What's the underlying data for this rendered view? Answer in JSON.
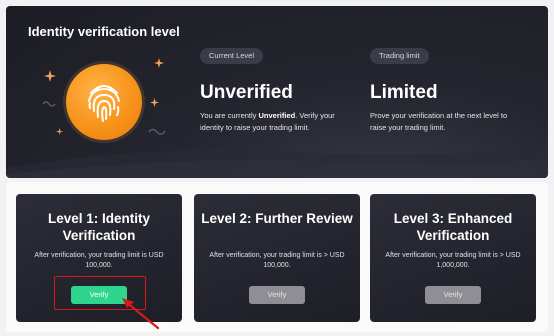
{
  "hero": {
    "title": "Identity verification level",
    "current_level": {
      "badge": "Current Level",
      "status": "Unverified",
      "desc_prefix": "You are currently ",
      "desc_bold": "Unverified",
      "desc_suffix": ". Verify your identity to raise your trading limit."
    },
    "trading_limit": {
      "badge": "Trading limit",
      "status": "Limited",
      "desc": "Prove your verification at the next level to raise your trading limit."
    }
  },
  "levels": [
    {
      "title": "Level 1: Identity Verification",
      "desc": "After verification, your trading limit is USD 100,000.",
      "button": "Verify",
      "state": "active"
    },
    {
      "title": "Level 2: Further Review",
      "desc": "After verification, your trading limit is > USD 100,000.",
      "button": "Verify",
      "state": "disabled"
    },
    {
      "title": "Level 3: Enhanced Verification",
      "desc": "After verification, your trading limit is > USD 1,000,000.",
      "button": "Verify",
      "state": "disabled"
    }
  ],
  "colors": {
    "accent_green": "#2fd58c",
    "accent_orange": "#f7931a",
    "highlight_red": "#d61a1a"
  },
  "icons": [
    "fingerprint-icon",
    "sparkle-icon",
    "arrow-pointer-icon"
  ]
}
